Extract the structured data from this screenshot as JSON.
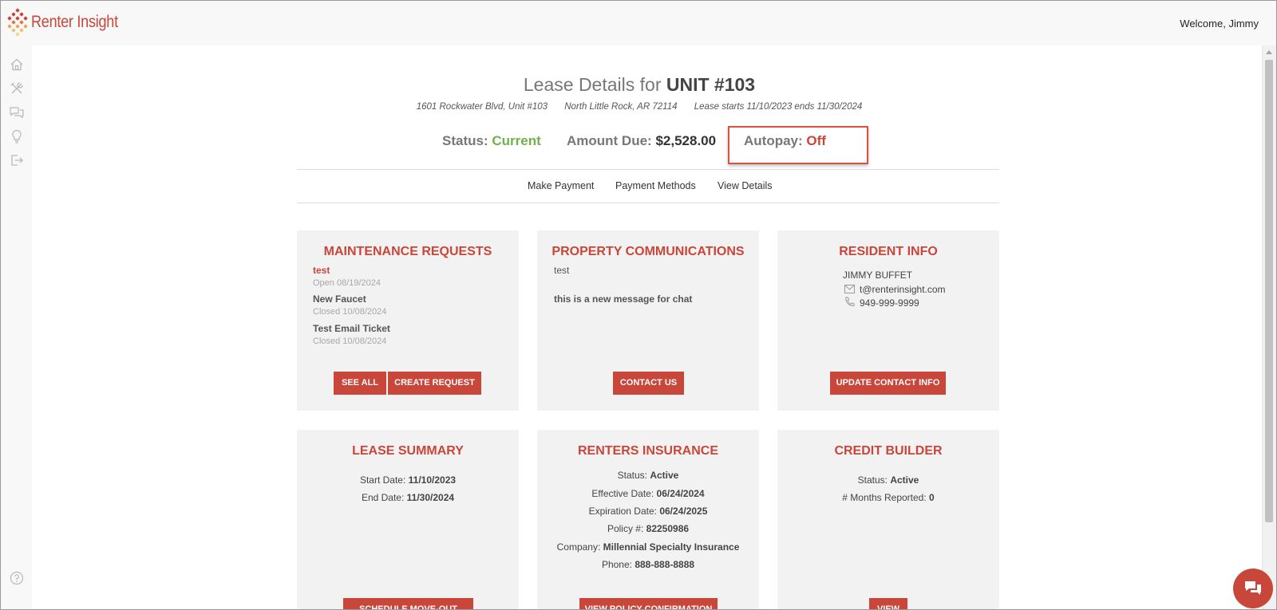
{
  "app": {
    "logo_text": "Renter Insight",
    "welcome": "Welcome, Jimmy"
  },
  "sidebar": {
    "icons": [
      "home-icon",
      "tools-icon",
      "chat-icon",
      "lightbulb-icon",
      "logout-icon"
    ],
    "bottom_icon": "help-icon"
  },
  "header": {
    "title_prefix": "Lease Details for",
    "title_unit": "UNIT #103",
    "address": "1601 Rockwater Blvd, Unit #103",
    "city": "North Little Rock, AR 72114",
    "lease_term": "Lease starts 11/10/2023 ends 11/30/2024",
    "status_label": "Status:",
    "status_value": "Current",
    "amount_label": "Amount Due:",
    "amount_value": "$2,528.00",
    "autopay_label": "Autopay:",
    "autopay_value": "Off"
  },
  "subnav": [
    "Make Payment",
    "Payment Methods",
    "View Details"
  ],
  "maintenance": {
    "title": "MAINTENANCE REQUESTS",
    "items": [
      {
        "name": "test",
        "status": "Open 08/19/2024"
      },
      {
        "name": "New Faucet",
        "status": "Closed 10/08/2024"
      },
      {
        "name": "Test Email Ticket",
        "status": "Closed 10/08/2024"
      }
    ],
    "buttons": [
      "SEE ALL",
      "CREATE REQUEST"
    ]
  },
  "communications": {
    "title": "PROPERTY COMMUNICATIONS",
    "subject": "test",
    "message": "this is a new message for chat",
    "button": "CONTACT US"
  },
  "resident": {
    "title": "RESIDENT INFO",
    "name": "JIMMY BUFFET",
    "email": "t@renterinsight.com",
    "phone": "949-999-9999",
    "button": "UPDATE CONTACT INFO"
  },
  "lease_summary": {
    "title": "LEASE SUMMARY",
    "start_label": "Start Date:",
    "start_value": "11/10/2023",
    "end_label": "End Date:",
    "end_value": "11/30/2024",
    "button": "SCHEDULE MOVE-OUT"
  },
  "insurance": {
    "title": "RENTERS INSURANCE",
    "rows": [
      {
        "label": "Status:",
        "value": "Active"
      },
      {
        "label": "Effective Date:",
        "value": "06/24/2024"
      },
      {
        "label": "Expiration Date:",
        "value": "06/24/2025"
      },
      {
        "label": "Policy #:",
        "value": "82250986"
      },
      {
        "label": "Company:",
        "value": "Millennial Specialty Insurance"
      },
      {
        "label": "Phone:",
        "value": "888-888-8888"
      }
    ],
    "button": "VIEW POLICY CONFIRMATION"
  },
  "credit": {
    "title": "CREDIT BUILDER",
    "status_label": "Status:",
    "status_value": "Active",
    "months_label": "# Months Reported:",
    "months_value": "0",
    "button": "VIEW"
  },
  "colors": {
    "accent": "#c8463a",
    "current": "#6fb24b",
    "card_bg": "#f2f2f2"
  }
}
